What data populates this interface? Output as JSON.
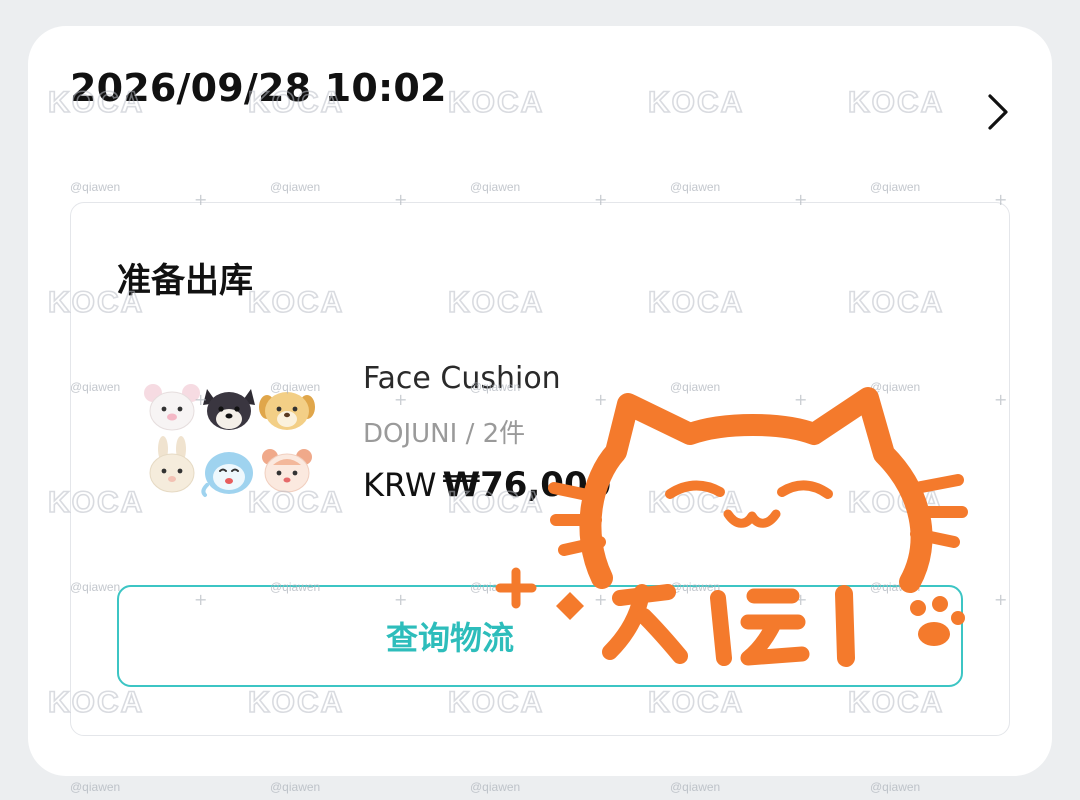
{
  "order": {
    "datetime": "2026/09/28 10:02"
  },
  "shipment": {
    "status": "准备出库",
    "track_button_label": "查询物流"
  },
  "product": {
    "name": "Face Cushion",
    "variant": "DOJUNI / 2件",
    "currency": "KRW",
    "price": "₩76,000"
  },
  "watermarks": {
    "logo": "KOCA",
    "handle": "@qiawen"
  },
  "icons": {
    "detail_chevron": "chevron-right-icon",
    "sticker": "orange-cat-sticker-icon"
  },
  "colors": {
    "accent": "#3cc5c4",
    "sticker": "#f47a2c",
    "card_background": "#ffffff",
    "page_background": "#eceef0"
  }
}
